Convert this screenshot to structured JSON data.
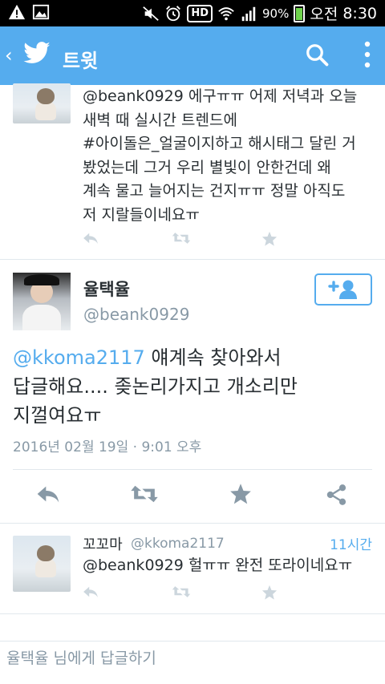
{
  "status_bar": {
    "battery": "90%",
    "time_period": "오전",
    "time": "8:30",
    "hd_label": "HD"
  },
  "app_bar": {
    "title": "트윗",
    "color": "#55acee"
  },
  "tweets": [
    {
      "text_lines": [
        "@beank0929 에구ㅠㅠ 어제 저녁과 오늘",
        "새벽 때 실시간 트렌드에",
        "#아이돌은_얼굴이지하고 해시태그 달린 거",
        "봤었는데 그거 우리 별빛이 안한건데 왜",
        "계속 물고 늘어지는 건지ㅠㅠ 정말 아직도",
        "저 지랄들이네요ㅠ"
      ]
    }
  ],
  "main_tweet": {
    "name": "율택율",
    "handle": "@beank0929",
    "mention": "@kkoma2117",
    "text_line1": " 얘계속 찾아와서",
    "text_line2": "답글해요.... 좆논리가지고 개소리만",
    "text_line3": "지껄여요ㅠ",
    "date": "2016년 02월 19일 · 9:01 오후"
  },
  "reply_tweet": {
    "name": "꼬꼬마",
    "handle": "@kkoma2117",
    "time": "11시간",
    "text": "@beank0929 헐ㅠㅠ 완전 또라이네요ㅠ"
  },
  "reply_box": {
    "placeholder": "율택율 님에게 답글하기"
  },
  "icons": {
    "back": "chevron-left-icon",
    "logo": "twitter-bird-icon",
    "search": "search-icon",
    "more": "more-vertical-icon",
    "reply": "reply-icon",
    "retweet": "retweet-icon",
    "favorite": "star-icon",
    "share": "share-icon",
    "follow": "follow-user-icon"
  }
}
